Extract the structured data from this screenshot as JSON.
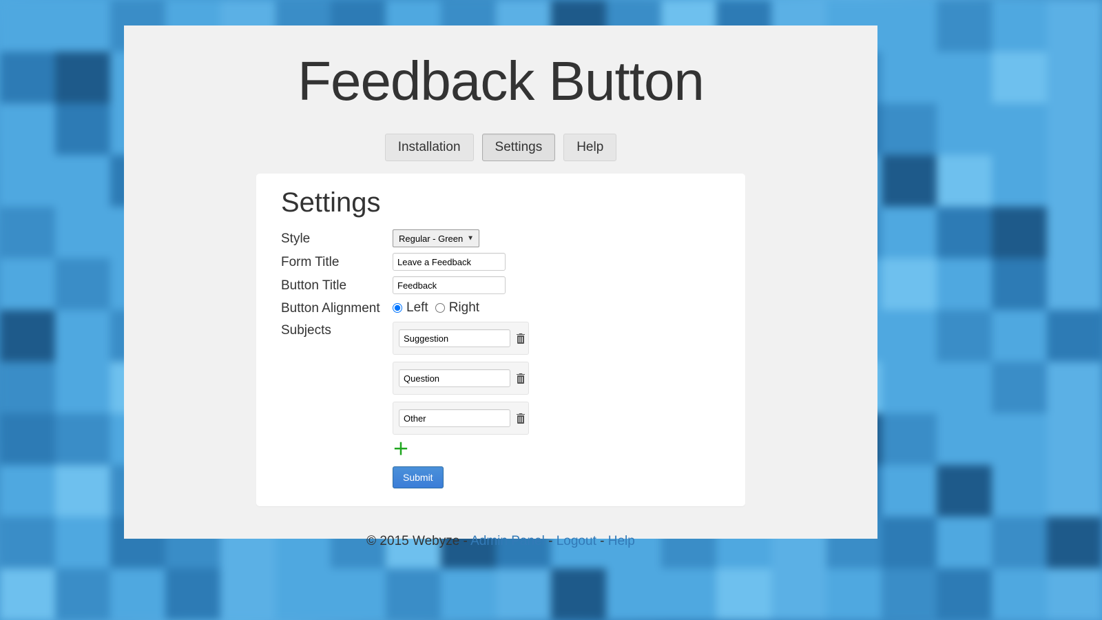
{
  "page_title": "Feedback Button",
  "tabs": {
    "installation": "Installation",
    "settings": "Settings",
    "help": "Help"
  },
  "settings": {
    "heading": "Settings",
    "labels": {
      "style": "Style",
      "form_title": "Form Title",
      "button_title": "Button Title",
      "button_alignment": "Button Alignment",
      "subjects": "Subjects"
    },
    "style_value": "Regular - Green",
    "form_title_value": "Leave a Feedback",
    "button_title_value": "Feedback",
    "alignment": {
      "left_label": "Left",
      "right_label": "Right",
      "selected": "left"
    },
    "subjects": [
      "Suggestion",
      "Question",
      "Other"
    ],
    "submit_label": "Submit"
  },
  "footer": {
    "copyright": "© 2015 Webyze - ",
    "admin_panel": "Admin Panel",
    "logout": "Logout",
    "help": "Help",
    "sep": " - "
  }
}
